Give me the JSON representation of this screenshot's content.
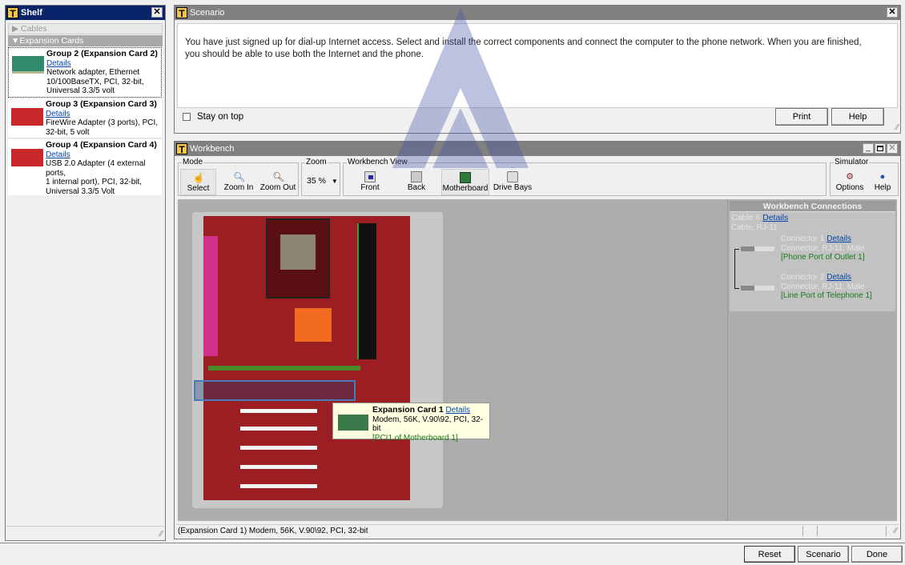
{
  "shelf": {
    "title": "Shelf",
    "sections": [
      {
        "label": "Cables",
        "expanded": false
      },
      {
        "label": "Expansion Cards",
        "expanded": true
      }
    ],
    "items": [
      {
        "title": "Group 2 (Expansion Card 2)",
        "details": "Details",
        "desc1": "Network adapter, Ethernet",
        "desc2": "10/100BaseTX, PCI, 32-bit,",
        "desc3": "Universal 3.3/5 volt"
      },
      {
        "title": "Group 3 (Expansion Card 3)",
        "details": "Details",
        "desc1": "FireWire Adapter (3 ports), PCI,",
        "desc2": "32-bit, 5 volt",
        "desc3": ""
      },
      {
        "title": "Group 4 (Expansion Card 4)",
        "details": "Details",
        "desc1": "USB 2.0 Adapter (4 external ports,",
        "desc2": "1 internal port), PCI, 32-bit,",
        "desc3": "Universal 3.3/5 Volt"
      }
    ]
  },
  "scenario": {
    "title": "Scenario",
    "text1": "You have just signed up for dial-up Internet access. Select and install the correct components and connect the computer to the phone network. When you are finished,",
    "text2": "you should be able to use both the Internet and the phone.",
    "stay_on_top": "Stay on top",
    "print": "Print",
    "help": "Help"
  },
  "workbench": {
    "title": "Workbench",
    "mode": {
      "label": "Mode",
      "select": "Select",
      "zoom_in": "Zoom In",
      "zoom_out": "Zoom Out"
    },
    "zoom": {
      "label": "Zoom",
      "value": "35 %"
    },
    "view": {
      "label": "Workbench View",
      "front": "Front",
      "back": "Back",
      "motherboard": "Motherboard",
      "drive_bays": "Drive Bays"
    },
    "simulator": {
      "label": "Simulator",
      "options": "Options",
      "help": "Help"
    },
    "tooltip": {
      "title": "Expansion Card 1",
      "details": "Details",
      "desc": "Modem, 56K, V.90\\92, PCI, 32-bit",
      "location": "[PCI1 of Motherboard 1]"
    },
    "connections": {
      "title": "Workbench Connections",
      "cable": "Cable 6",
      "cable_details": "Details",
      "cable_type": "Cable, RJ-11",
      "connectors": [
        {
          "name": "Connector 1",
          "details": "Details",
          "type": "Connector, RJ-11, Male",
          "target": "[Phone Port of Outlet 1]"
        },
        {
          "name": "Connector 2",
          "details": "Details",
          "type": "Connector, RJ-11, Male",
          "target": "[Line Port of Telephone 1]"
        }
      ]
    },
    "status": "(Expansion Card 1) Modem, 56K, V.90\\92, PCI, 32-bit"
  },
  "bottom": {
    "reset": "Reset",
    "scenario": "Scenario",
    "done": "Done"
  }
}
